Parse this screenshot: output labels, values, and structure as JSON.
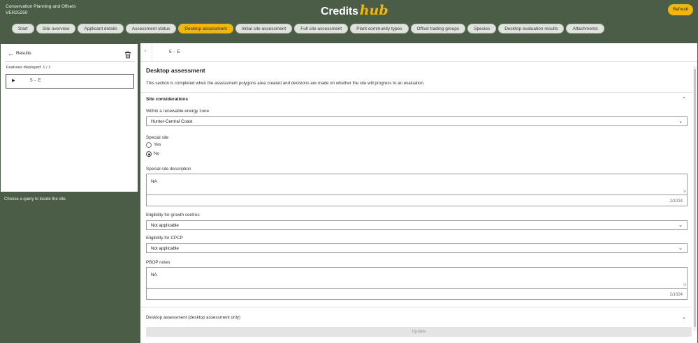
{
  "header": {
    "org_name": "Conservation Planning and Offsets",
    "org_code": "VER25250",
    "logo_credits": "Credits",
    "logo_hub": "hub",
    "refresh_label": "Refresh"
  },
  "tabs": [
    {
      "label": "Start"
    },
    {
      "label": "Site overview"
    },
    {
      "label": "Applicant details"
    },
    {
      "label": "Assessment status"
    },
    {
      "label": "Desktop assessment",
      "active": true
    },
    {
      "label": "Initial site assessment"
    },
    {
      "label": "Full site assessment"
    },
    {
      "label": "Plant community types"
    },
    {
      "label": "Offset trading groups"
    },
    {
      "label": "Species"
    },
    {
      "label": "Desktop evaluation results"
    },
    {
      "label": "Attachments"
    }
  ],
  "left_panel": {
    "results_label": "Results",
    "features_displayed": "Features displayed: 1 / 1",
    "result_item": "5 - E",
    "hint": "Choose a query to locate the site."
  },
  "main": {
    "record_id": "5 - E",
    "title": "Desktop assessment",
    "description": "This section is completed when the assessment polygons area created and decisions are made on whether the site will progress to an evaluation.",
    "section_title": "Site considerations",
    "renewable_zone": {
      "label": "Within a renewable energy zone",
      "value": "Hunter-Central Coast"
    },
    "special_site": {
      "label": "Special site",
      "options": [
        "Yes",
        "No"
      ],
      "selected": "No"
    },
    "special_site_description": {
      "label": "Special site description",
      "value": "NA",
      "counter": "2/1024"
    },
    "growth_centres": {
      "label": "Eligibility for growth centres",
      "value": "Not applicable"
    },
    "cpcp": {
      "label": "Eligibility for CPCP",
      "value": "Not applicable"
    },
    "pbop_notes": {
      "label": "PBOP notes",
      "value": "NA",
      "counter": "2/1024"
    },
    "collapsed_section": "Desktop assessment (desktop assessment only)",
    "update_label": "Update"
  },
  "colors": {
    "brand_green": "#4b5d47",
    "accent_yellow": "#f2b705"
  }
}
